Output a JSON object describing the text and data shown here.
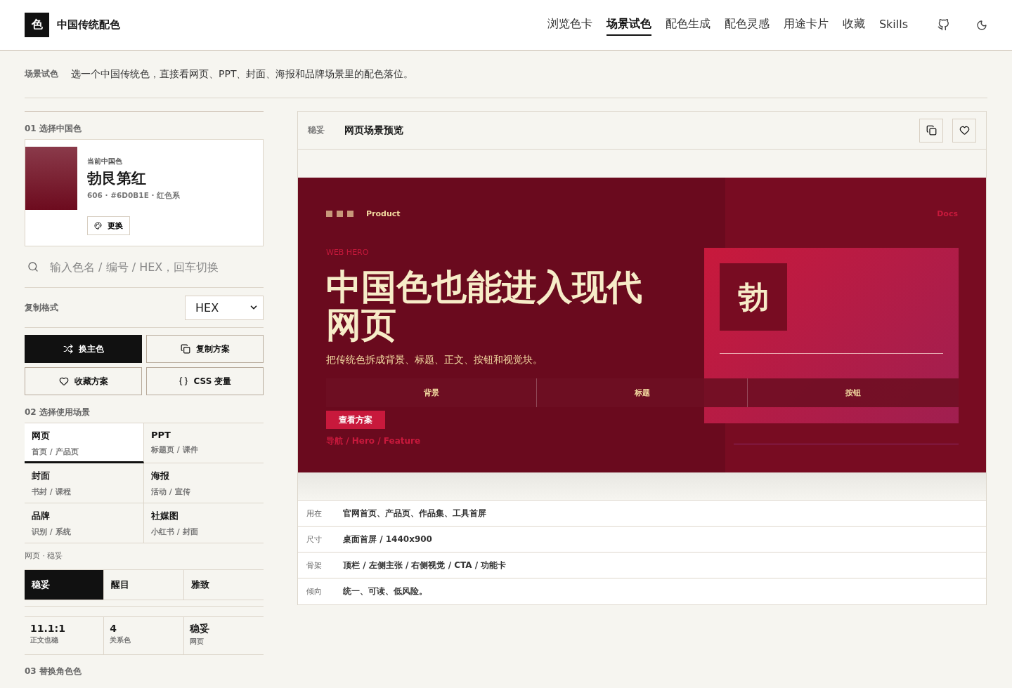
{
  "header": {
    "logo": "色",
    "title": "中国传统配色",
    "nav": [
      {
        "label": "浏览色卡",
        "selected": false
      },
      {
        "label": "场景试色",
        "selected": true
      },
      {
        "label": "配色生成",
        "selected": false
      },
      {
        "label": "配色灵感",
        "selected": false
      },
      {
        "label": "用途卡片",
        "selected": false
      },
      {
        "label": "收藏",
        "selected": false
      },
      {
        "label": "Skills",
        "selected": false
      }
    ]
  },
  "intro": {
    "label": "场景试色",
    "text": "选一个中国传统色，直接看网页、PPT、封面、海报和品牌场景里的配色落位。"
  },
  "sidebar": {
    "step1": {
      "num": "01",
      "label": "选择中国色"
    },
    "current": {
      "caption": "当前中国色",
      "name": "勃艮第红",
      "color": "#6d0b1e",
      "meta": "606 · #6D0B1E · 红色系",
      "change": "更换"
    },
    "search": {
      "placeholder": "输入色名 / 编号 / HEX，回车切换"
    },
    "format": {
      "label": "复制格式",
      "value": "HEX"
    },
    "actions": [
      {
        "label": "换主色",
        "kind": "shuffle",
        "primary": true
      },
      {
        "label": "复制方案",
        "kind": "copy",
        "primary": false
      },
      {
        "label": "收藏方案",
        "kind": "heart",
        "primary": false
      },
      {
        "label": "CSS 变量",
        "kind": "braces",
        "primary": false
      }
    ],
    "step2": {
      "num": "02",
      "label": "选择使用场景"
    },
    "scenes": [
      {
        "title": "网页",
        "sub": "首页 / 产品页",
        "selected": true
      },
      {
        "title": "PPT",
        "sub": "标题页 / 课件",
        "selected": false
      },
      {
        "title": "封面",
        "sub": "书封 / 课程",
        "selected": false
      },
      {
        "title": "海报",
        "sub": "活动 / 宣传",
        "selected": false
      },
      {
        "title": "品牌",
        "sub": "识别 / 系统",
        "selected": false
      },
      {
        "title": "社媒图",
        "sub": "小红书 / 封面",
        "selected": false
      }
    ],
    "scene_caption": "网页 · 稳妥",
    "tones": [
      {
        "label": "稳妥",
        "selected": true
      },
      {
        "label": "醒目",
        "selected": false
      },
      {
        "label": "雅致",
        "selected": false
      }
    ],
    "stats": [
      {
        "value": "11.1:1",
        "label": "正文也稳"
      },
      {
        "value": "4",
        "label": "关系色"
      },
      {
        "value": "稳妥",
        "label": "网页"
      }
    ],
    "step3": {
      "num": "03",
      "label": "替换角色色"
    }
  },
  "preview": {
    "tag": "稳妥",
    "title": "网页场景预览",
    "hero": {
      "nav_left": "Product",
      "nav_right": "Docs",
      "eyebrow": "WEB HERO",
      "headline": "中国色也能进入现代网页",
      "subtitle": "把传统色拆成背景、标题、正文、按钮和视觉块。",
      "cta": "查看方案",
      "trail": "导航 / Hero / Feature",
      "mark": "勃",
      "tabs": [
        "背景",
        "标题",
        "按钮"
      ]
    },
    "info": [
      {
        "label": "用在",
        "value": "官网首页、产品页、作品集、工具首屏"
      },
      {
        "label": "尺寸",
        "value": "桌面首屏 / 1440x900"
      },
      {
        "label": "骨架",
        "value": "顶栏 / 左侧主张 / 右侧视觉 / CTA / 功能卡"
      },
      {
        "label": "倾向",
        "value": "统一、可读、低风险。"
      }
    ]
  }
}
